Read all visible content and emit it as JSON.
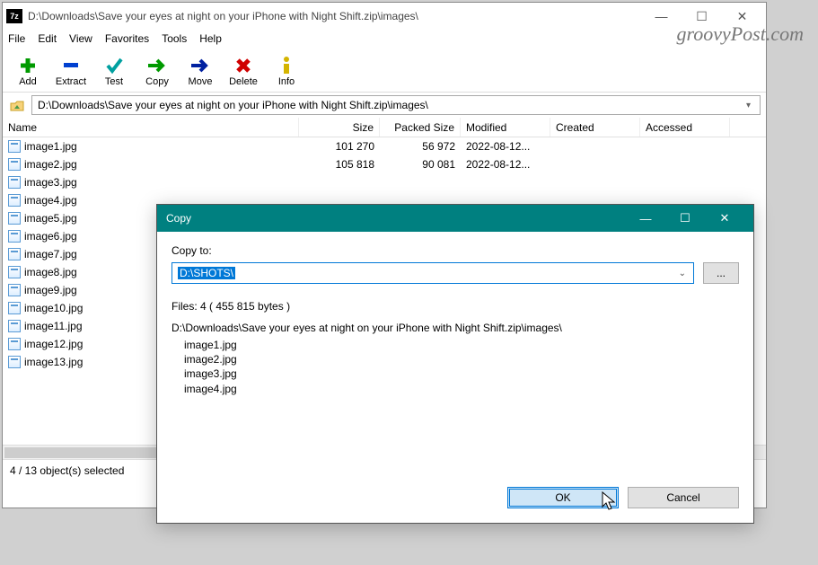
{
  "window": {
    "title": "D:\\Downloads\\Save your eyes at night on your iPhone with Night Shift.zip\\images\\",
    "app_icon_text": "7z"
  },
  "menu": {
    "file": "File",
    "edit": "Edit",
    "view": "View",
    "favorites": "Favorites",
    "tools": "Tools",
    "help": "Help"
  },
  "toolbar": {
    "add": "Add",
    "extract": "Extract",
    "test": "Test",
    "copy": "Copy",
    "move": "Move",
    "delete": "Delete",
    "info": "Info"
  },
  "path": "D:\\Downloads\\Save your eyes at night on your iPhone with Night Shift.zip\\images\\",
  "columns": {
    "name": "Name",
    "size": "Size",
    "packed": "Packed Size",
    "modified": "Modified",
    "created": "Created",
    "accessed": "Accessed"
  },
  "rows": [
    {
      "name": "image1.jpg",
      "size": "101 270",
      "packed": "56 972",
      "modified": "2022-08-12..."
    },
    {
      "name": "image2.jpg",
      "size": "105 818",
      "packed": "90 081",
      "modified": "2022-08-12..."
    },
    {
      "name": "image3.jpg"
    },
    {
      "name": "image4.jpg"
    },
    {
      "name": "image5.jpg"
    },
    {
      "name": "image6.jpg"
    },
    {
      "name": "image7.jpg"
    },
    {
      "name": "image8.jpg"
    },
    {
      "name": "image9.jpg"
    },
    {
      "name": "image10.jpg"
    },
    {
      "name": "image11.jpg"
    },
    {
      "name": "image12.jpg"
    },
    {
      "name": "image13.jpg"
    }
  ],
  "status": "4 / 13 object(s) selected",
  "dialog": {
    "title": "Copy",
    "copy_to_label": "Copy to:",
    "destination": "D:\\SHOTS\\",
    "browse": "...",
    "summary": "Files: 4    ( 455 815 bytes )",
    "source_path": "D:\\Downloads\\Save your eyes at night on your iPhone with Night Shift.zip\\images\\",
    "files": [
      "image1.jpg",
      "image2.jpg",
      "image3.jpg",
      "image4.jpg"
    ],
    "ok": "OK",
    "cancel": "Cancel"
  },
  "watermark": "groovyPost.com"
}
